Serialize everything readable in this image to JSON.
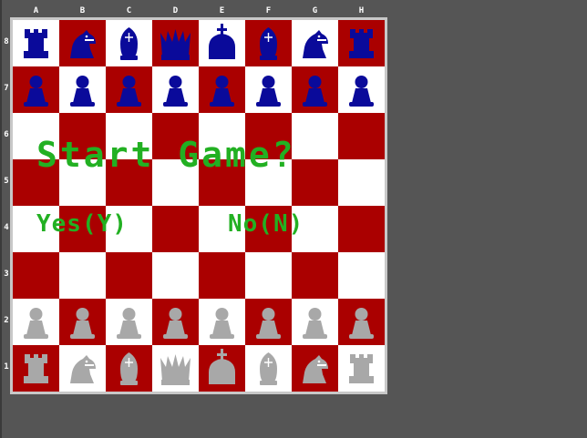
{
  "files": [
    "A",
    "B",
    "C",
    "D",
    "E",
    "F",
    "G",
    "H"
  ],
  "ranks": [
    "8",
    "7",
    "6",
    "5",
    "4",
    "3",
    "2",
    "1"
  ],
  "colors": {
    "light_square": "#ffffff",
    "dark_square": "#aa0000",
    "black_pieces": "#0a0a9a",
    "white_pieces": "#a8a8a8",
    "text": "#22b022",
    "background": "#555555"
  },
  "board": [
    [
      "black-rook",
      "black-knight",
      "black-bishop",
      "black-queen",
      "black-king",
      "black-bishop",
      "black-knight",
      "black-rook"
    ],
    [
      "black-pawn",
      "black-pawn",
      "black-pawn",
      "black-pawn",
      "black-pawn",
      "black-pawn",
      "black-pawn",
      "black-pawn"
    ],
    [
      "",
      "",
      "",
      "",
      "",
      "",
      "",
      ""
    ],
    [
      "",
      "",
      "",
      "",
      "",
      "",
      "",
      ""
    ],
    [
      "",
      "",
      "",
      "",
      "",
      "",
      "",
      ""
    ],
    [
      "",
      "",
      "",
      "",
      "",
      "",
      "",
      ""
    ],
    [
      "white-pawn",
      "white-pawn",
      "white-pawn",
      "white-pawn",
      "white-pawn",
      "white-pawn",
      "white-pawn",
      "white-pawn"
    ],
    [
      "white-rook",
      "white-knight",
      "white-bishop",
      "white-queen",
      "white-king",
      "white-bishop",
      "white-knight",
      "white-rook"
    ]
  ],
  "dialog": {
    "title": "Start Game?",
    "yes_label": "Yes(Y)",
    "no_label": "No(N)"
  }
}
